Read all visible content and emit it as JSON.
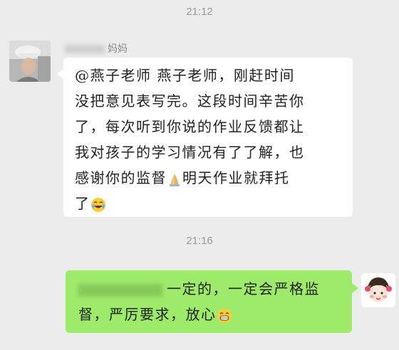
{
  "chat": {
    "timestamp_1": "21:12",
    "timestamp_2": "21:16",
    "incoming": {
      "sender_name": "妈妈",
      "line1": "@燕子老师  燕子老师，刚赶时间",
      "line2": "没把意见表写完。这段时间辛苦你",
      "line3": "了，每次听到你说的作业反馈都让",
      "line4": "我对孩子的学习情况有了了解，也",
      "line5": "感谢你的监督",
      "line5b": "明天作业就拜托",
      "line6": "了",
      "icon_pray": "praying-hands-emoji",
      "icon_laugh": "laughing-emoji"
    },
    "outgoing": {
      "line1": "一定的，一定会严格监",
      "line2": "督，严厉要求，放心",
      "icon_grin": "grinning-emoji"
    },
    "colors": {
      "background": "#ececec",
      "incoming_bubble": "#ffffff",
      "outgoing_bubble": "#9eea6a",
      "timestamp": "#9a9a9a"
    }
  }
}
